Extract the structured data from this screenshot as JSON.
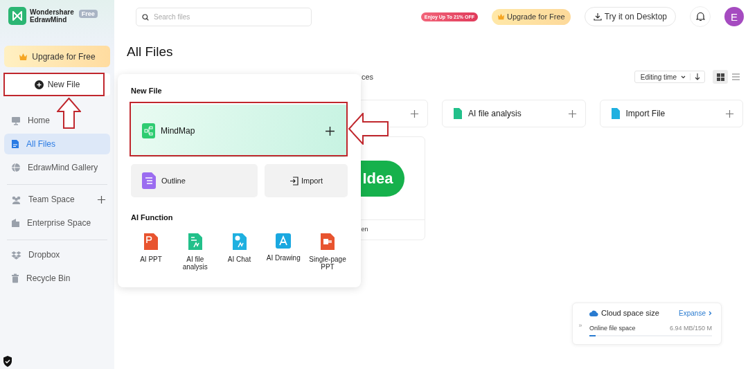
{
  "sidebar": {
    "logo": {
      "line_1": "Wondershare",
      "line_2": "EdrawMind",
      "badge": "Free"
    },
    "upgrade_button": "Upgrade for Free",
    "new_file_button": "New File",
    "groups": [
      {
        "items": [
          {
            "label": "Home",
            "selected": false,
            "has_add": false
          },
          {
            "label": "All Files",
            "selected": true,
            "has_add": false
          },
          {
            "label": "EdrawMind Gallery",
            "selected": false,
            "has_add": false
          }
        ]
      },
      {
        "items": [
          {
            "label": "Team Space",
            "selected": false,
            "has_add": true
          },
          {
            "label": "Enterprise Space",
            "selected": false,
            "has_add": false
          }
        ]
      },
      {
        "items": [
          {
            "label": "Dropbox",
            "selected": false,
            "has_add": false
          },
          {
            "label": "Recycle Bin",
            "selected": false,
            "has_add": false
          }
        ]
      }
    ]
  },
  "top_bar": {
    "search": {
      "placeholder": "Search files"
    },
    "promo_badge": "Enjoy Up To 21% OFF",
    "upgrade_button": "Upgrade for Free",
    "desktop_button": "Try it on Desktop",
    "avatar": "E"
  },
  "main": {
    "title": "All Files",
    "tab_fragment": "ces",
    "sort": {
      "label": "Editing time"
    },
    "views": [
      {
        "selected": true
      },
      {
        "selected": false
      }
    ],
    "quick_create": [
      {
        "kind": "partial"
      },
      {
        "kind": "card",
        "label": "AI file analysis",
        "color": "#22c08a"
      },
      {
        "kind": "card",
        "label": "Import File",
        "color": "#1fb0e0"
      }
    ],
    "template_card": {
      "title_fragment": "Idea",
      "caption_fragment": "en"
    }
  },
  "popup": {
    "title": "New File",
    "primary": {
      "label": "MindMap"
    },
    "secondary": [
      {
        "label": "Outline"
      },
      {
        "label": "Import"
      }
    ],
    "section_title": "AI Function",
    "ai_items": [
      {
        "label": "AI PPT",
        "color": "#e8542f"
      },
      {
        "label": "AI file analysis",
        "color": "#22c08a"
      },
      {
        "label": "AI Chat",
        "color": "#1fb0e0"
      },
      {
        "label": "AI Drawing",
        "color": "#1aa8e0"
      },
      {
        "label": "Single-page PPT",
        "color": "#e8542f"
      }
    ]
  },
  "cloud": {
    "collapse": "»",
    "title": "Cloud space size",
    "link": "Expanse",
    "row_label": "Online file space",
    "usage": "6.94 MB/150 M",
    "level": 0.05
  },
  "annotations": {
    "frame_new_file": true,
    "frame_mindmap": true
  }
}
